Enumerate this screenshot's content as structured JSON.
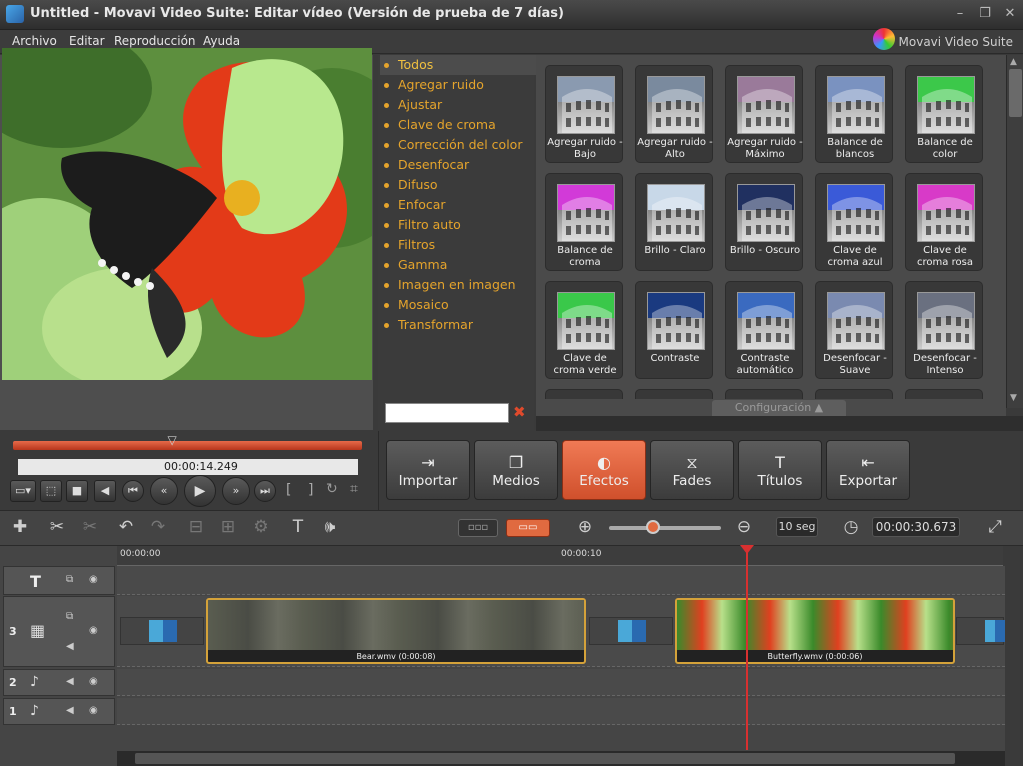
{
  "window": {
    "title": "Untitled - Movavi Video Suite: Editar vídeo (Versión de prueba de 7 días)",
    "brand": "Movavi Video Suite"
  },
  "menu": [
    "Archivo",
    "Editar",
    "Reproducción",
    "Ayuda"
  ],
  "categories": [
    "Todos",
    "Agregar ruido",
    "Ajustar",
    "Clave de croma",
    "Corrección del color",
    "Desenfocar",
    "Difuso",
    "Enfocar",
    "Filtro auto",
    "Filtros",
    "Gamma",
    "Imagen en imagen",
    "Mosaico",
    "Transformar"
  ],
  "selected_category": "Todos",
  "category_search": {
    "value": "",
    "clear_icon": "clear-icon"
  },
  "effects": [
    {
      "label": "Agregar ruido - Bajo",
      "tint": "#8a9ab0"
    },
    {
      "label": "Agregar ruido - Alto",
      "tint": "#7a8a9e"
    },
    {
      "label": "Agregar ruido - Máximo",
      "tint": "#9a7a9a"
    },
    {
      "label": "Balance de blancos",
      "tint": "#7a92c0"
    },
    {
      "label": "Balance de color",
      "tint": "#3cc84a"
    },
    {
      "label": "Balance de croma",
      "tint": "#d23ad8"
    },
    {
      "label": "Brillo - Claro",
      "tint": "#c8d8e8"
    },
    {
      "label": "Brillo - Oscuro",
      "tint": "#203060"
    },
    {
      "label": "Clave de croma azul",
      "tint": "#3a5ad8"
    },
    {
      "label": "Clave de croma rosa",
      "tint": "#d83ac8"
    },
    {
      "label": "Clave de croma verde",
      "tint": "#3ac84a"
    },
    {
      "label": "Contraste",
      "tint": "#1a3a80"
    },
    {
      "label": "Contraste automático",
      "tint": "#3a6ac0"
    },
    {
      "label": "Desenfocar - Suave",
      "tint": "#7a8ab0"
    },
    {
      "label": "Desenfocar - Intenso",
      "tint": "#6a7080"
    }
  ],
  "config_label": "Configuración",
  "transport": {
    "current_time": "00:00:14.249",
    "progress": 0.46
  },
  "mode_tabs": [
    {
      "label": "Importar",
      "icon": "import-icon",
      "active": false
    },
    {
      "label": "Medios",
      "icon": "media-icon",
      "active": false
    },
    {
      "label": "Efectos",
      "icon": "effects-icon",
      "active": true
    },
    {
      "label": "Fades",
      "icon": "fades-icon",
      "active": false
    },
    {
      "label": "Títulos",
      "icon": "titles-icon",
      "active": false
    },
    {
      "label": "Exportar",
      "icon": "export-icon",
      "active": false
    }
  ],
  "timeline": {
    "zoom_level": "10 seg",
    "duration": "00:00:30.673",
    "ruler_labels": [
      "00:00:00",
      "00:00:10"
    ],
    "tracks": [
      {
        "number": "",
        "type": "titles"
      },
      {
        "number": "3",
        "type": "video"
      },
      {
        "number": "2",
        "type": "audio"
      },
      {
        "number": "1",
        "type": "audio"
      }
    ],
    "clips": [
      {
        "name": "Bear.wmv (0:00:08)"
      },
      {
        "name": "Butterfly.wmv (0:00:06)"
      }
    ]
  }
}
